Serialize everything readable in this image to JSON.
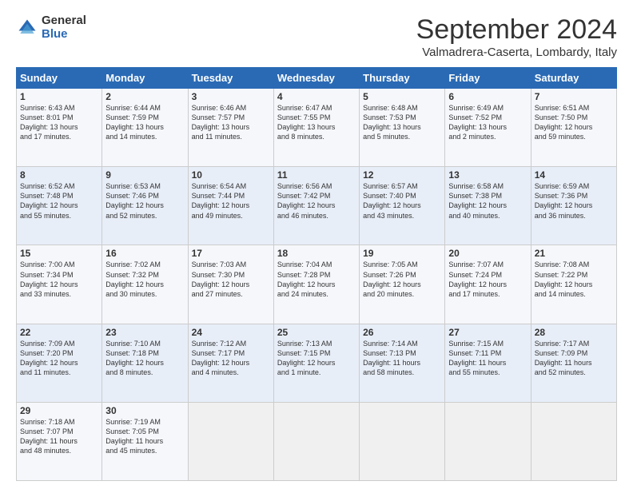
{
  "logo": {
    "general": "General",
    "blue": "Blue"
  },
  "header": {
    "month": "September 2024",
    "location": "Valmadrera-Caserta, Lombardy, Italy"
  },
  "weekdays": [
    "Sunday",
    "Monday",
    "Tuesday",
    "Wednesday",
    "Thursday",
    "Friday",
    "Saturday"
  ],
  "weeks": [
    [
      {
        "day": "1",
        "info": "Sunrise: 6:43 AM\nSunset: 8:01 PM\nDaylight: 13 hours\nand 17 minutes."
      },
      {
        "day": "2",
        "info": "Sunrise: 6:44 AM\nSunset: 7:59 PM\nDaylight: 13 hours\nand 14 minutes."
      },
      {
        "day": "3",
        "info": "Sunrise: 6:46 AM\nSunset: 7:57 PM\nDaylight: 13 hours\nand 11 minutes."
      },
      {
        "day": "4",
        "info": "Sunrise: 6:47 AM\nSunset: 7:55 PM\nDaylight: 13 hours\nand 8 minutes."
      },
      {
        "day": "5",
        "info": "Sunrise: 6:48 AM\nSunset: 7:53 PM\nDaylight: 13 hours\nand 5 minutes."
      },
      {
        "day": "6",
        "info": "Sunrise: 6:49 AM\nSunset: 7:52 PM\nDaylight: 13 hours\nand 2 minutes."
      },
      {
        "day": "7",
        "info": "Sunrise: 6:51 AM\nSunset: 7:50 PM\nDaylight: 12 hours\nand 59 minutes."
      }
    ],
    [
      {
        "day": "8",
        "info": "Sunrise: 6:52 AM\nSunset: 7:48 PM\nDaylight: 12 hours\nand 55 minutes."
      },
      {
        "day": "9",
        "info": "Sunrise: 6:53 AM\nSunset: 7:46 PM\nDaylight: 12 hours\nand 52 minutes."
      },
      {
        "day": "10",
        "info": "Sunrise: 6:54 AM\nSunset: 7:44 PM\nDaylight: 12 hours\nand 49 minutes."
      },
      {
        "day": "11",
        "info": "Sunrise: 6:56 AM\nSunset: 7:42 PM\nDaylight: 12 hours\nand 46 minutes."
      },
      {
        "day": "12",
        "info": "Sunrise: 6:57 AM\nSunset: 7:40 PM\nDaylight: 12 hours\nand 43 minutes."
      },
      {
        "day": "13",
        "info": "Sunrise: 6:58 AM\nSunset: 7:38 PM\nDaylight: 12 hours\nand 40 minutes."
      },
      {
        "day": "14",
        "info": "Sunrise: 6:59 AM\nSunset: 7:36 PM\nDaylight: 12 hours\nand 36 minutes."
      }
    ],
    [
      {
        "day": "15",
        "info": "Sunrise: 7:00 AM\nSunset: 7:34 PM\nDaylight: 12 hours\nand 33 minutes."
      },
      {
        "day": "16",
        "info": "Sunrise: 7:02 AM\nSunset: 7:32 PM\nDaylight: 12 hours\nand 30 minutes."
      },
      {
        "day": "17",
        "info": "Sunrise: 7:03 AM\nSunset: 7:30 PM\nDaylight: 12 hours\nand 27 minutes."
      },
      {
        "day": "18",
        "info": "Sunrise: 7:04 AM\nSunset: 7:28 PM\nDaylight: 12 hours\nand 24 minutes."
      },
      {
        "day": "19",
        "info": "Sunrise: 7:05 AM\nSunset: 7:26 PM\nDaylight: 12 hours\nand 20 minutes."
      },
      {
        "day": "20",
        "info": "Sunrise: 7:07 AM\nSunset: 7:24 PM\nDaylight: 12 hours\nand 17 minutes."
      },
      {
        "day": "21",
        "info": "Sunrise: 7:08 AM\nSunset: 7:22 PM\nDaylight: 12 hours\nand 14 minutes."
      }
    ],
    [
      {
        "day": "22",
        "info": "Sunrise: 7:09 AM\nSunset: 7:20 PM\nDaylight: 12 hours\nand 11 minutes."
      },
      {
        "day": "23",
        "info": "Sunrise: 7:10 AM\nSunset: 7:18 PM\nDaylight: 12 hours\nand 8 minutes."
      },
      {
        "day": "24",
        "info": "Sunrise: 7:12 AM\nSunset: 7:17 PM\nDaylight: 12 hours\nand 4 minutes."
      },
      {
        "day": "25",
        "info": "Sunrise: 7:13 AM\nSunset: 7:15 PM\nDaylight: 12 hours\nand 1 minute."
      },
      {
        "day": "26",
        "info": "Sunrise: 7:14 AM\nSunset: 7:13 PM\nDaylight: 11 hours\nand 58 minutes."
      },
      {
        "day": "27",
        "info": "Sunrise: 7:15 AM\nSunset: 7:11 PM\nDaylight: 11 hours\nand 55 minutes."
      },
      {
        "day": "28",
        "info": "Sunrise: 7:17 AM\nSunset: 7:09 PM\nDaylight: 11 hours\nand 52 minutes."
      }
    ],
    [
      {
        "day": "29",
        "info": "Sunrise: 7:18 AM\nSunset: 7:07 PM\nDaylight: 11 hours\nand 48 minutes."
      },
      {
        "day": "30",
        "info": "Sunrise: 7:19 AM\nSunset: 7:05 PM\nDaylight: 11 hours\nand 45 minutes."
      },
      {
        "day": "",
        "info": ""
      },
      {
        "day": "",
        "info": ""
      },
      {
        "day": "",
        "info": ""
      },
      {
        "day": "",
        "info": ""
      },
      {
        "day": "",
        "info": ""
      }
    ]
  ]
}
